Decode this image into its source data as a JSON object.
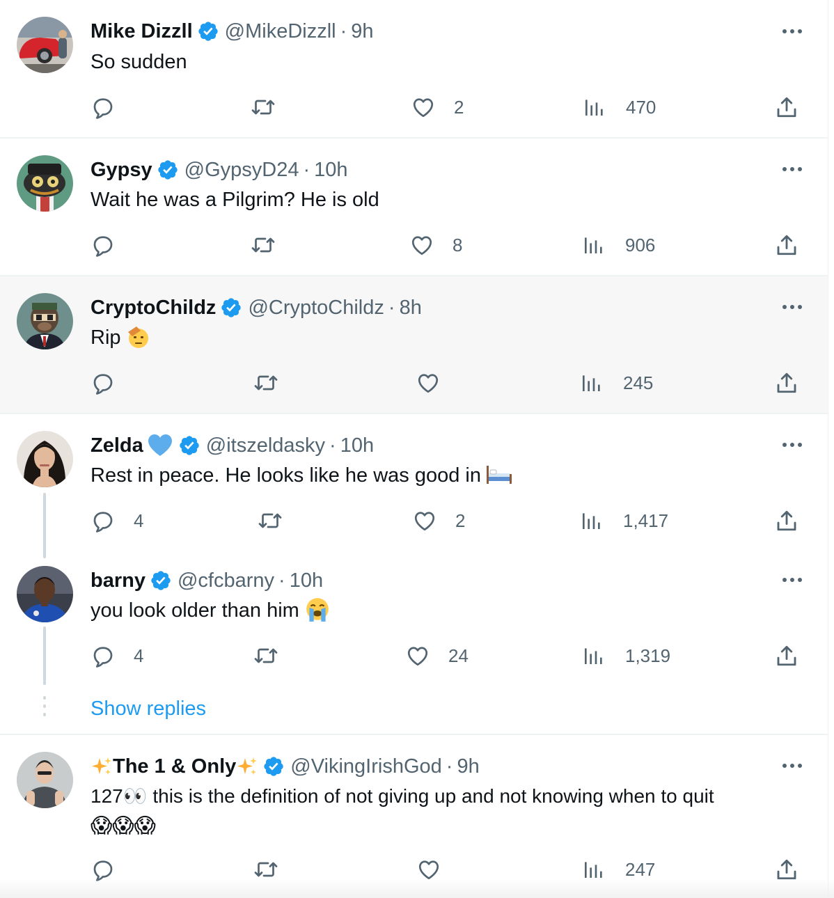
{
  "tweets": [
    {
      "name": "Mike Dizzll",
      "handle": "@MikeDizzll",
      "time": "9h",
      "text": "So sudden",
      "replies": "",
      "likes": "2",
      "views": "470",
      "avatar_icon": "car-avatar"
    },
    {
      "name": "Gypsy",
      "handle": "@GypsyD24",
      "time": "10h",
      "text": "Wait he was a Pilgrim? He is old",
      "replies": "",
      "likes": "8",
      "views": "906",
      "avatar_icon": "nft-avatar"
    },
    {
      "name": "CryptoChildz",
      "handle": "@CryptoChildz",
      "time": "8h",
      "text": "Rip",
      "replies": "",
      "likes": "",
      "views": "245",
      "emoji": "saluting-face",
      "avatar_icon": "ape-avatar"
    },
    {
      "name": "Zelda",
      "handle": "@itszeldasky",
      "time": "10h",
      "text": "Rest in peace. He looks like he was good in",
      "replies": "4",
      "likes": "2",
      "views": "1,417",
      "emoji": "bed",
      "name_emoji": "blue-heart",
      "avatar_icon": "woman-avatar"
    },
    {
      "name": "barny",
      "handle": "@cfcbarny",
      "time": "10h",
      "text": "you look older than him",
      "replies": "4",
      "likes": "24",
      "views": "1,319",
      "emoji": "loudly-crying-face",
      "avatar_icon": "footballer-avatar"
    },
    {
      "name": "The 1 & Only",
      "handle": "@VikingIrishGod",
      "time": "9h",
      "text": "127👀 this is the definition of not giving up and not knowing when to quit",
      "text_line2": "😱😱😱",
      "replies": "",
      "likes": "",
      "views": "247",
      "avatar_icon": "man-avatar"
    }
  ],
  "show_replies_label": "Show replies",
  "separator": "·",
  "colors": {
    "verified": "#1d9bf0",
    "secondary_text": "#536471",
    "link": "#1d9bf0",
    "highlight_bg": "#f7f7f7"
  }
}
